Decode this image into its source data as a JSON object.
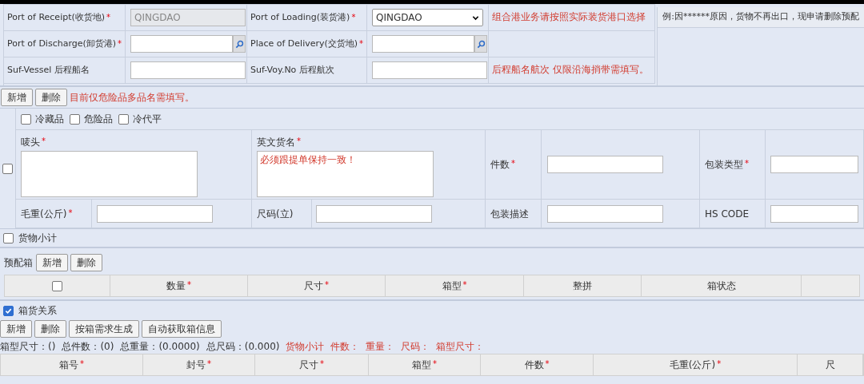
{
  "required_mark": "*",
  "shipment_rows": [
    {
      "cells": [
        {
          "label": "Port of Receipt(收货地)",
          "required": true,
          "kind": "text",
          "value": "QINGDAO",
          "disabled": true
        },
        {
          "label": "Port of Loading(装货港)",
          "required": true,
          "kind": "select",
          "value": "QINGDAO",
          "disabled": false
        }
      ],
      "note": "组合港业务请按照实际装货港口选择"
    },
    {
      "cells": [
        {
          "label": "Port of Discharge(卸货港)",
          "required": true,
          "kind": "lookup",
          "disabled": false
        },
        {
          "label": "Place of Delivery(交货地)",
          "required": true,
          "kind": "lookup",
          "disabled": false
        }
      ]
    },
    {
      "cells": [
        {
          "label": "Suf-Vessel 后程船名",
          "required": false,
          "kind": "text",
          "disabled": false
        },
        {
          "label": "Suf-Voy.No 后程航次",
          "required": false,
          "kind": "text",
          "disabled": false
        }
      ],
      "note": "后程船名航次 仅限沿海捎带需填写。"
    }
  ],
  "remark_example": "例:因******原因，货物不再出口，现申请删除预配",
  "cargo": {
    "buttons": [
      "新增",
      "删除"
    ],
    "hint": "目前仅危险品多品名需填写。",
    "row_checked": false,
    "flags": [
      {
        "label": "冷藏品",
        "checked": false
      },
      {
        "label": "危险品",
        "checked": false
      },
      {
        "label": "冷代平",
        "checked": false
      }
    ],
    "marks": {
      "label": "唛头",
      "required": true
    },
    "english_name": {
      "label": "英文货名",
      "required": true,
      "placeholder": "必须跟提单保持一致！"
    },
    "pieces": {
      "label": "件数",
      "required": true
    },
    "package_type": {
      "label": "包装类型",
      "required": true
    },
    "gross_weight": {
      "label": "毛重(公斤)",
      "required": true
    },
    "measurement": {
      "label": "尺码(立)",
      "required": false
    },
    "package_desc": {
      "label": "包装描述",
      "required": false
    },
    "hs_code": {
      "label": "HS CODE",
      "required": false
    }
  },
  "cargo_subtotal": {
    "label": "货物小计",
    "checked": false
  },
  "precontainers": {
    "label": "预配箱",
    "buttons": [
      "新增",
      "删除"
    ],
    "all_checked": false,
    "columns": [
      {
        "label": "数量",
        "required": true
      },
      {
        "label": "尺寸",
        "required": true
      },
      {
        "label": "箱型",
        "required": true
      },
      {
        "label": "整拼",
        "required": false
      },
      {
        "label": "箱状态",
        "required": false
      }
    ]
  },
  "container_cargo": {
    "label": "箱货关系",
    "checked": true,
    "buttons": [
      "新增",
      "删除",
      "按箱需求生成",
      "自动获取箱信息"
    ],
    "totals": [
      "箱型尺寸：()",
      "总件数：(0)",
      "总重量：(0.0000)",
      "总尺码：(0.000)"
    ],
    "subtotals": [
      "货物小计",
      "件数：",
      "重量：",
      "尺码：",
      "箱型尺寸："
    ],
    "columns": [
      {
        "label": "箱号",
        "required": true
      },
      {
        "label": "封号",
        "required": true
      },
      {
        "label": "尺寸",
        "required": true
      },
      {
        "label": "箱型",
        "required": true
      },
      {
        "label": "件数",
        "required": true
      },
      {
        "label": "毛重(公斤)",
        "required": true
      },
      {
        "label": "尺",
        "required": false
      }
    ]
  }
}
